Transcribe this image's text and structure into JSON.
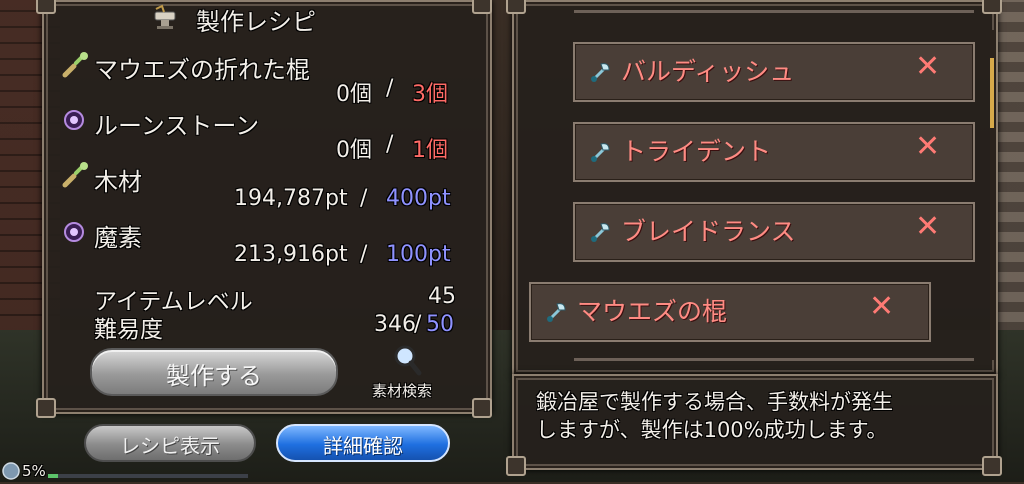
{
  "window_title": "製作レシピ",
  "materials": [
    {
      "name": "マウエズの折れた棍",
      "have": "0個",
      "sep": "/",
      "need": "3個",
      "icon": "broken-staff-icon"
    },
    {
      "name": "ルーンストーン",
      "have": "0個",
      "sep": "/",
      "need": "1個",
      "icon": "rune-stone-icon"
    },
    {
      "name": "木材",
      "have": "194,787pt",
      "sep": "/",
      "need": "400pt",
      "icon": "wood-icon"
    },
    {
      "name": "魔素",
      "have": "213,916pt",
      "sep": "/",
      "need": "100pt",
      "icon": "magic-essence-icon"
    }
  ],
  "item_level_label": "アイテムレベル",
  "item_level_value": "45",
  "difficulty_label": "難易度",
  "difficulty_value": "346",
  "difficulty_sep": "/",
  "difficulty_max": "50",
  "craft_button": "製作する",
  "material_search": "素材検索",
  "recipe_show_button": "レシピ表示",
  "details_button": "詳細確認",
  "status_percent": "5%",
  "recipes": [
    {
      "name": "バルディッシュ",
      "mark": "✕"
    },
    {
      "name": "トライデント",
      "mark": "✕"
    },
    {
      "name": "ブレイドランス",
      "mark": "✕"
    },
    {
      "name": "マウエズの棍",
      "mark": "✕"
    }
  ],
  "info_text_line1": "鍛冶屋で製作する場合、手数料が発生",
  "info_text_line2": "しますが、製作は100%成功します。",
  "colors": {
    "need_red": "#ff6b66",
    "need_blue": "#8f92ff",
    "recipe_red": "#ff8b83",
    "details_button": "#1f6fe0"
  }
}
